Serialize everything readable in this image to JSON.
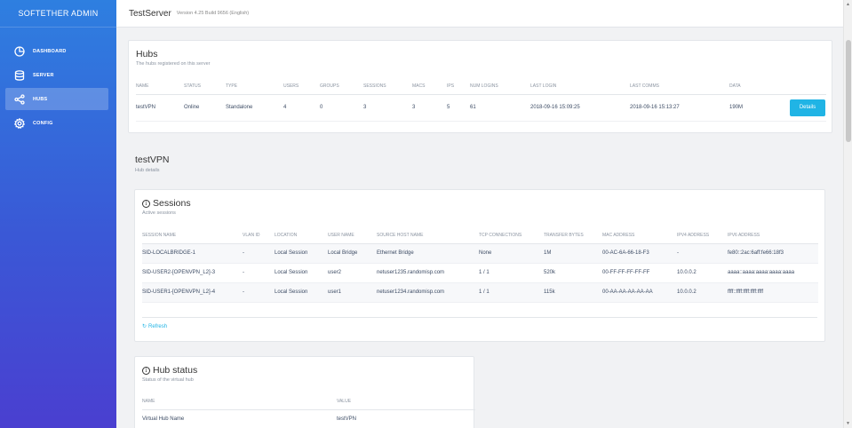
{
  "sidebar": {
    "brand": "SOFTETHER ADMIN",
    "items": [
      {
        "label": "DASHBOARD",
        "icon": "dashboard-icon"
      },
      {
        "label": "SERVER",
        "icon": "database-icon"
      },
      {
        "label": "HUBS",
        "icon": "share-icon",
        "active": true
      },
      {
        "label": "CONFIG",
        "icon": "gear-icon"
      }
    ]
  },
  "header": {
    "server_name": "TestServer",
    "version": "Version 4.25 Build 9656 (English)"
  },
  "hubs_card": {
    "title": "Hubs",
    "subtitle": "The hubs registered on this server",
    "columns": [
      "NAME",
      "STATUS",
      "TYPE",
      "USERS",
      "GROUPS",
      "SESSIONS",
      "MACS",
      "IPS",
      "NUM LOGINS",
      "LAST LOGIN",
      "LAST COMMS",
      "DATA"
    ],
    "rows": [
      {
        "name": "testVPN",
        "status": "Online",
        "type": "Standalone",
        "users": "4",
        "groups": "0",
        "sessions": "3",
        "macs": "3",
        "ips": "5",
        "num_logins": "61",
        "last_login": "2018-09-16 15:09:25",
        "last_comms": "2018-09-16 15:13:27",
        "data": "190M",
        "action": "Details"
      }
    ]
  },
  "hub_section": {
    "title": "testVPN",
    "subtitle": "Hub details"
  },
  "sessions_card": {
    "title": "Sessions",
    "subtitle": "Active sessions",
    "columns": [
      "SESSION NAME",
      "VLAN ID",
      "LOCATION",
      "USER NAME",
      "SOURCE HOST NAME",
      "TCP CONNECTIONS",
      "TRANSFER BYTES",
      "MAC ADDRESS",
      "IPV4 ADDRESS",
      "IPV6 ADDRESS"
    ],
    "rows": [
      [
        "SID-LOCALBRIDGE-1",
        "-",
        "Local Session",
        "Local Bridge",
        "Ethernet Bridge",
        "None",
        "1M",
        "00-AC-6A-66-18-F3",
        "-",
        "fe80::2ac:6aff:fe66:18f3"
      ],
      [
        "SID-USER2-[OPENVPN_L2]-3",
        "-",
        "Local Session",
        "user2",
        "netuser1235.randomisp.com",
        "1 / 1",
        "520k",
        "00-FF-FF-FF-FF-FF",
        "10.0.0.2",
        "aaaa::aaaa:aaaa:aaaa:aaaa"
      ],
      [
        "SID-USER1-[OPENVPN_L2]-4",
        "-",
        "Local Session",
        "user1",
        "netuser1234.randomisp.com",
        "1 / 1",
        "115k",
        "00-AA-AA-AA-AA-AA",
        "10.0.0.2",
        "ffff::ffff:ffff:ffff:ffff"
      ]
    ],
    "refresh_label": "Refresh"
  },
  "hub_status_card": {
    "title": "Hub status",
    "subtitle": "Status of the virtual hub",
    "columns": [
      "NAME",
      "VALUE"
    ],
    "rows": [
      [
        "Virtual Hub Name",
        "testVPN"
      ]
    ]
  },
  "colors": {
    "sidebar_top": "#2e7fe0",
    "sidebar_bottom": "#4a3fd0",
    "accent": "#20b4e5"
  }
}
